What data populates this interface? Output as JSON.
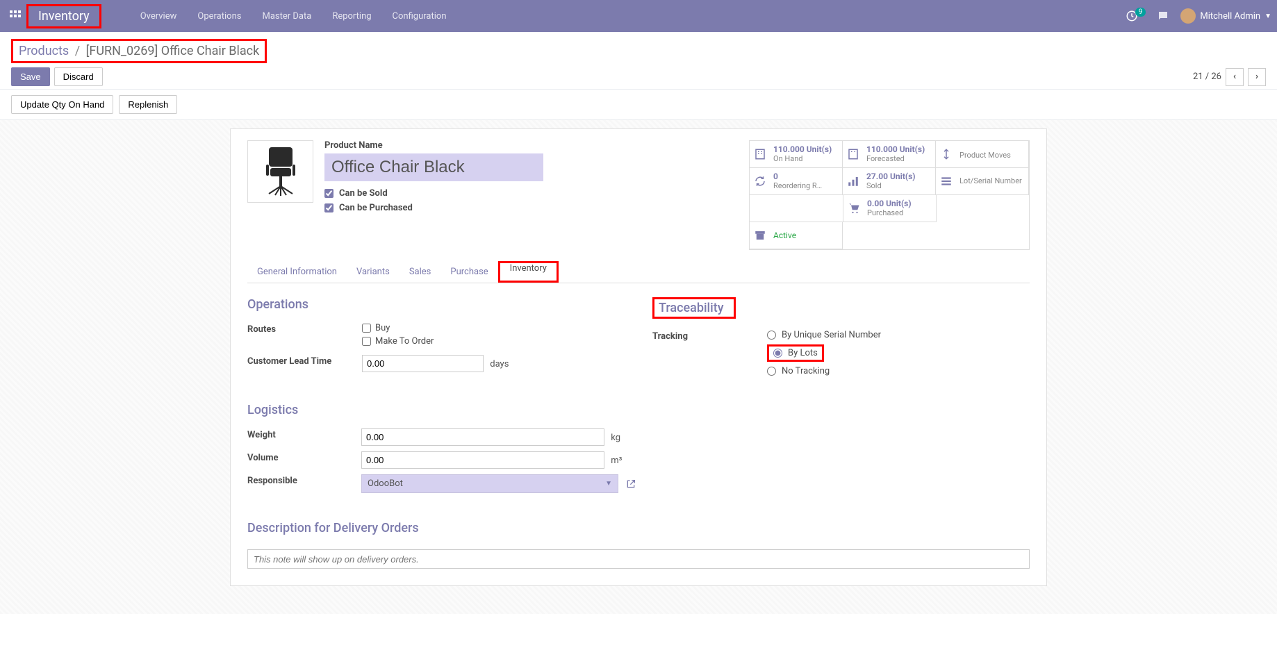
{
  "topnav": {
    "brand": "Inventory",
    "menu": [
      "Overview",
      "Operations",
      "Master Data",
      "Reporting",
      "Configuration"
    ],
    "notif_count": "9",
    "user": "Mitchell Admin"
  },
  "breadcrumb": {
    "parent": "Products",
    "current": "[FURN_0269] Office Chair Black"
  },
  "buttons": {
    "save": "Save",
    "discard": "Discard",
    "update_qty": "Update Qty On Hand",
    "replenish": "Replenish"
  },
  "pager": {
    "text": "21 / 26"
  },
  "product": {
    "label": "Product Name",
    "name": "Office Chair Black",
    "can_be_sold": "Can be Sold",
    "can_be_purchased": "Can be Purchased"
  },
  "stats": {
    "on_hand": {
      "value": "110.000 Unit(s)",
      "label": "On Hand"
    },
    "forecasted": {
      "value": "110.000 Unit(s)",
      "label": "Forecasted"
    },
    "product_moves": {
      "label": "Product Moves"
    },
    "reordering": {
      "value": "0",
      "label": "Reordering R…"
    },
    "sold": {
      "value": "27.00 Unit(s)",
      "label": "Sold"
    },
    "lot_serial": {
      "label": "Lot/Serial Number"
    },
    "purchased": {
      "value": "0.00 Unit(s)",
      "label": "Purchased"
    },
    "active": {
      "label": "Active"
    }
  },
  "tabs": {
    "general": "General Information",
    "variants": "Variants",
    "sales": "Sales",
    "purchase": "Purchase",
    "inventory": "Inventory"
  },
  "operations": {
    "title": "Operations",
    "routes_label": "Routes",
    "route_buy": "Buy",
    "route_mto": "Make To Order",
    "lead_time_label": "Customer Lead Time",
    "lead_time_value": "0.00",
    "lead_time_unit": "days"
  },
  "traceability": {
    "title": "Traceability",
    "tracking_label": "Tracking",
    "opt_serial": "By Unique Serial Number",
    "opt_lots": "By Lots",
    "opt_none": "No Tracking"
  },
  "logistics": {
    "title": "Logistics",
    "weight_label": "Weight",
    "weight_value": "0.00",
    "weight_unit": "kg",
    "volume_label": "Volume",
    "volume_value": "0.00",
    "volume_unit": "m³",
    "responsible_label": "Responsible",
    "responsible_value": "OdooBot"
  },
  "delivery_desc": {
    "title": "Description for Delivery Orders",
    "placeholder": "This note will show up on delivery orders."
  }
}
